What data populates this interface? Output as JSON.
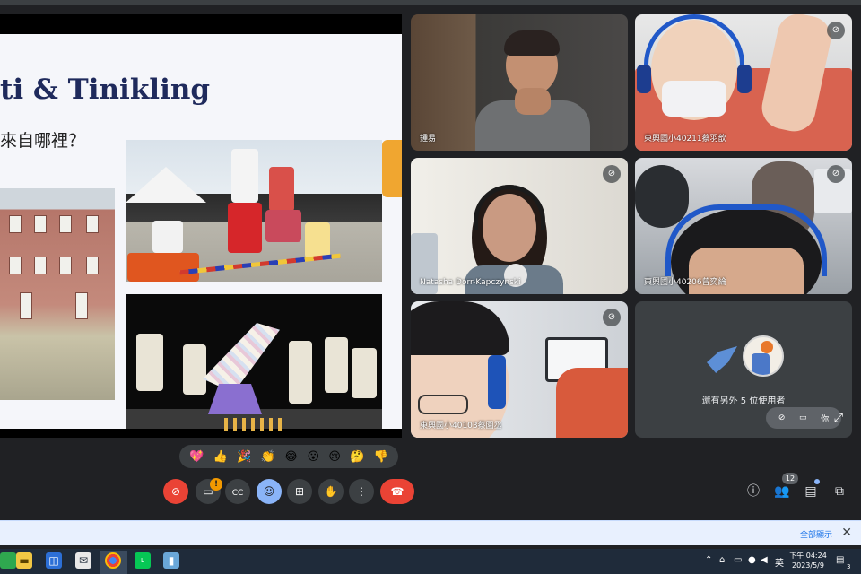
{
  "slide": {
    "title": "ti & Tinikling",
    "subtitle": "來自哪裡？"
  },
  "participants": [
    {
      "name": "鍾易",
      "muted": false
    },
    {
      "name": "東興國小40211蔡羽歆",
      "muted": true
    },
    {
      "name": "Natasha Dorr-Kapczynski",
      "muted": true
    },
    {
      "name": "東興國小40206曾奕綸",
      "muted": true
    },
    {
      "name": "東興國小40103蔡園丞",
      "muted": true
    }
  ],
  "others_tile": {
    "text": "還有另外 5 位使用者",
    "you_label": "你"
  },
  "reactions": [
    "💖",
    "👍",
    "🎉",
    "👏",
    "😂",
    "😮",
    "😢",
    "🤔",
    "👎"
  ],
  "controls": {
    "camera_badge": "!"
  },
  "right_controls": {
    "people_count": "12"
  },
  "notice": {
    "text": "全部顯示",
    "close": "✕"
  },
  "taskbar": {
    "ime": "英",
    "time": "下午 04:24",
    "date": "2023/5/9",
    "notifications": "3"
  },
  "colors": {
    "meet_bg": "#202124",
    "tile_bg": "#3c4043",
    "end_call": "#ea4335",
    "accent_blue": "#8ab4f8"
  }
}
